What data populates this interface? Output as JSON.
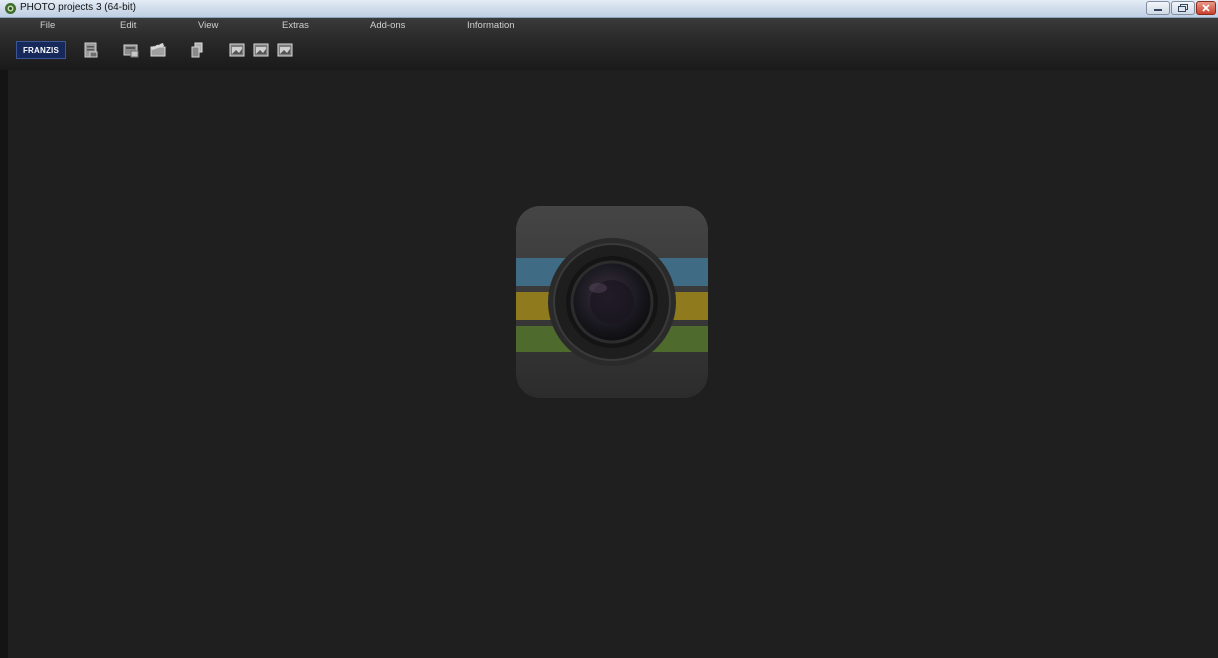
{
  "window": {
    "title": "PHOTO projects 3 (64-bit)",
    "controls": [
      "minimize-icon",
      "maximize-icon",
      "close-icon"
    ]
  },
  "menu": {
    "items": [
      "File",
      "Edit",
      "View",
      "Extras",
      "Add-ons",
      "Information"
    ]
  },
  "toolbar": {
    "brand_label": "FRANZIS",
    "tools": [
      "new-project-icon",
      "open-project-icon",
      "slideshow-icon",
      "copy-icon",
      "export-image-icon-1",
      "export-image-icon-2",
      "export-image-icon-3"
    ]
  },
  "logo": {
    "icon": "camera-lens-logo",
    "stripe_colors": [
      "#3f6c84",
      "#8f7a1e",
      "#4e6a2c"
    ]
  }
}
